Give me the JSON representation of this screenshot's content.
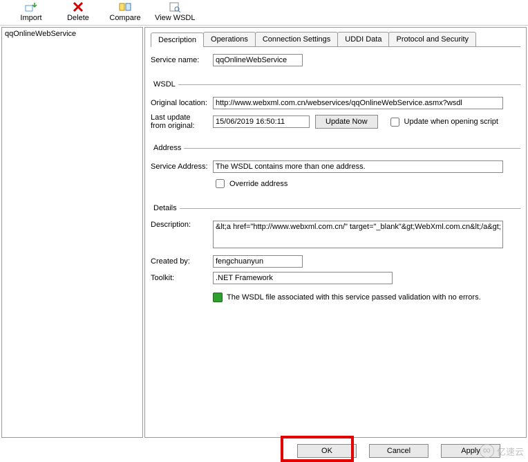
{
  "toolbar": {
    "import": "Import",
    "delete": "Delete",
    "compare": "Compare",
    "view_wsdl": "View WSDL"
  },
  "tree": {
    "root": "qqOnlineWebService"
  },
  "tabs": {
    "description": "Description",
    "operations": "Operations",
    "connection": "Connection Settings",
    "uddi": "UDDI Data",
    "protocol": "Protocol and Security"
  },
  "form": {
    "service_name_label": "Service name:",
    "service_name_value": "qqOnlineWebService",
    "wsdl_legend": "WSDL",
    "orig_loc_label": "Original location:",
    "orig_loc_value": "http://www.webxml.com.cn/webservices/qqOnlineWebService.asmx?wsdl",
    "last_update_label_1": "Last update",
    "last_update_label_2": "from original:",
    "last_update_value": "15/06/2019 16:50:11",
    "update_now": "Update Now",
    "update_open": "Update when opening script",
    "address_legend": "Address",
    "svc_addr_label": "Service Address:",
    "svc_addr_value": "The WSDL contains more than one address.",
    "override": "Override address",
    "details_legend": "Details",
    "description_label": "Description:",
    "description_value": "&lt;a href=\"http://www.webxml.com.cn/\" target=\"_blank\"&gt;WebXml.com.cn&lt;/a&gt;",
    "created_by_label": "Created by:",
    "created_by_value": "fengchuanyun",
    "toolkit_label": "Toolkit:",
    "toolkit_value": ".NET Framework",
    "status_msg": "The WSDL file associated with this service passed validation with no errors."
  },
  "buttons": {
    "ok": "OK",
    "cancel": "Cancel",
    "apply": "Apply"
  },
  "watermark": "亿速云"
}
